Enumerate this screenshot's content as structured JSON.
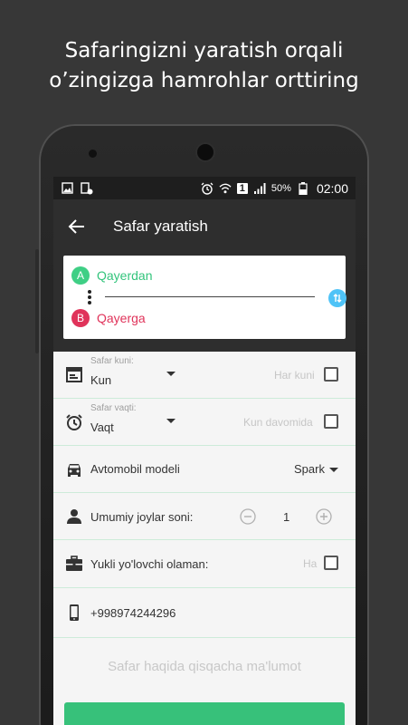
{
  "promo": {
    "line1": "Safaringizni yaratish orqali",
    "line2": "o’zingizga hamrohlar orttiring"
  },
  "status_bar": {
    "sim_badge": "1",
    "battery_percent": "50%",
    "time": "02:00",
    "icons": [
      "image-icon",
      "download-icon",
      "alarm-icon",
      "wifi-icon",
      "signal-icon",
      "battery-icon"
    ]
  },
  "app_bar": {
    "title": "Safar yaratish",
    "back_icon": "arrow-left-icon"
  },
  "route": {
    "from_badge": "A",
    "from_label": "Qayerdan",
    "to_badge": "B",
    "to_label": "Qayerga",
    "from_color": "#3fcf85",
    "to_color": "#e0335a",
    "swap_icon": "swap-vertical-icon"
  },
  "form": {
    "date": {
      "label": "Safar kuni:",
      "value": "Kun",
      "option": "Har kuni",
      "checked": false
    },
    "time": {
      "label": "Safar vaqti:",
      "value": "Vaqt",
      "option": "Kun davomida",
      "checked": false
    },
    "car": {
      "label": "Avtomobil modeli",
      "value": "Spark"
    },
    "seats": {
      "label": "Umumiy joylar soni:",
      "value": "1"
    },
    "luggage": {
      "label": "Yukli yo'lovchi olaman:",
      "option": "Ha",
      "checked": false
    },
    "phone": {
      "value": "+998974244296"
    },
    "about_placeholder": "Safar haqida qisqacha ma'lumot"
  },
  "colors": {
    "accent_green": "#37c17a",
    "divider": "#cdebd9",
    "app_bar": "#2e2e2e"
  }
}
